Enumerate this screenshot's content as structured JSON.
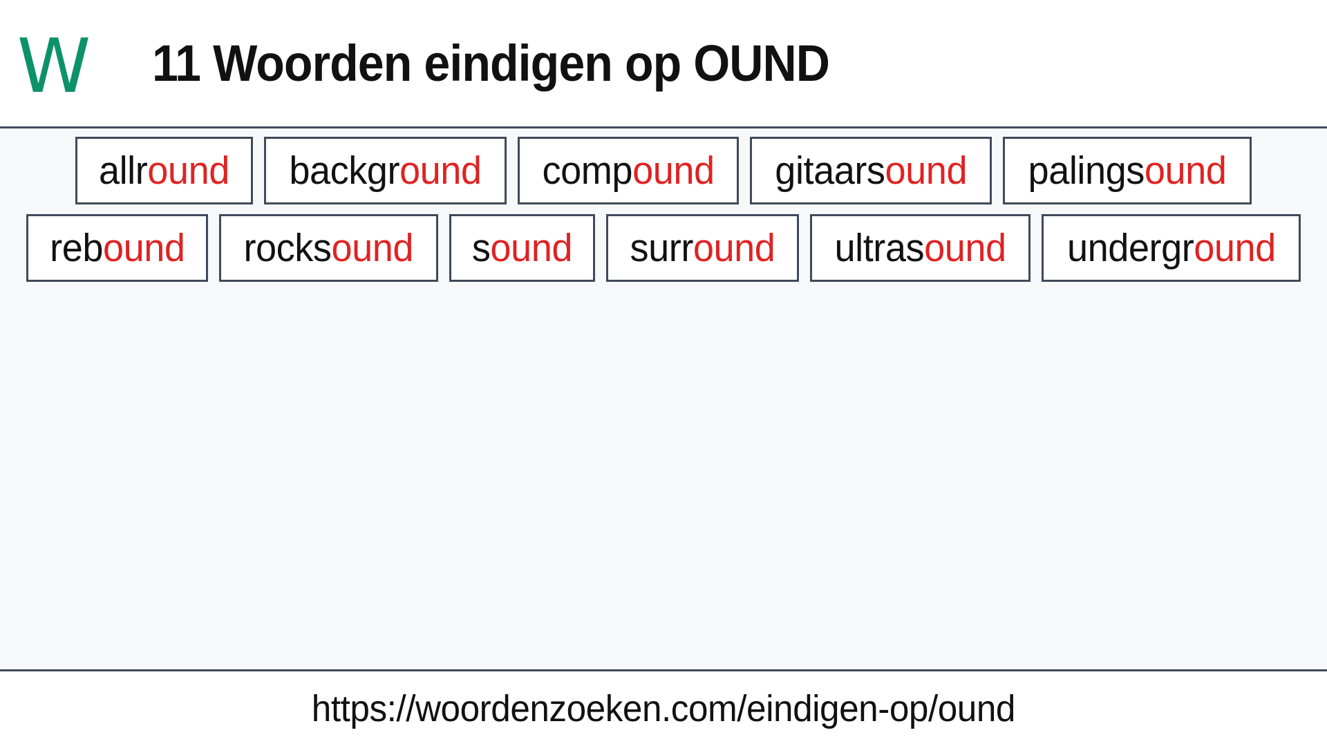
{
  "header": {
    "logo_text": "W",
    "logo_color": "#0d9268",
    "title": "11 Woorden eindigen op OUND"
  },
  "theme": {
    "border_color": "#3f4a5a",
    "main_background": "#f6f8fa",
    "highlight_color": "#e02222",
    "text_color": "#111111"
  },
  "main": {
    "suffix": "ound",
    "word_count": 11,
    "rows": [
      {
        "words": [
          {
            "full": "allround",
            "prefix": "allr",
            "highlight": "ound"
          },
          {
            "full": "background",
            "prefix": "backgr",
            "highlight": "ound"
          },
          {
            "full": "compound",
            "prefix": "comp",
            "highlight": "ound"
          },
          {
            "full": "gitaarsound",
            "prefix": "gitaars",
            "highlight": "ound"
          },
          {
            "full": "palingsound",
            "prefix": "palings",
            "highlight": "ound"
          }
        ]
      },
      {
        "words": [
          {
            "full": "rebound",
            "prefix": "reb",
            "highlight": "ound"
          },
          {
            "full": "rocksound",
            "prefix": "rocks",
            "highlight": "ound"
          },
          {
            "full": "sound",
            "prefix": "s",
            "highlight": "ound"
          },
          {
            "full": "surround",
            "prefix": "surr",
            "highlight": "ound"
          },
          {
            "full": "ultrasound",
            "prefix": "ultras",
            "highlight": "ound"
          },
          {
            "full": "underground",
            "prefix": "undergr",
            "highlight": "ound"
          }
        ]
      }
    ]
  },
  "footer": {
    "url": "https://woordenzoeken.com/eindigen-op/ound"
  }
}
